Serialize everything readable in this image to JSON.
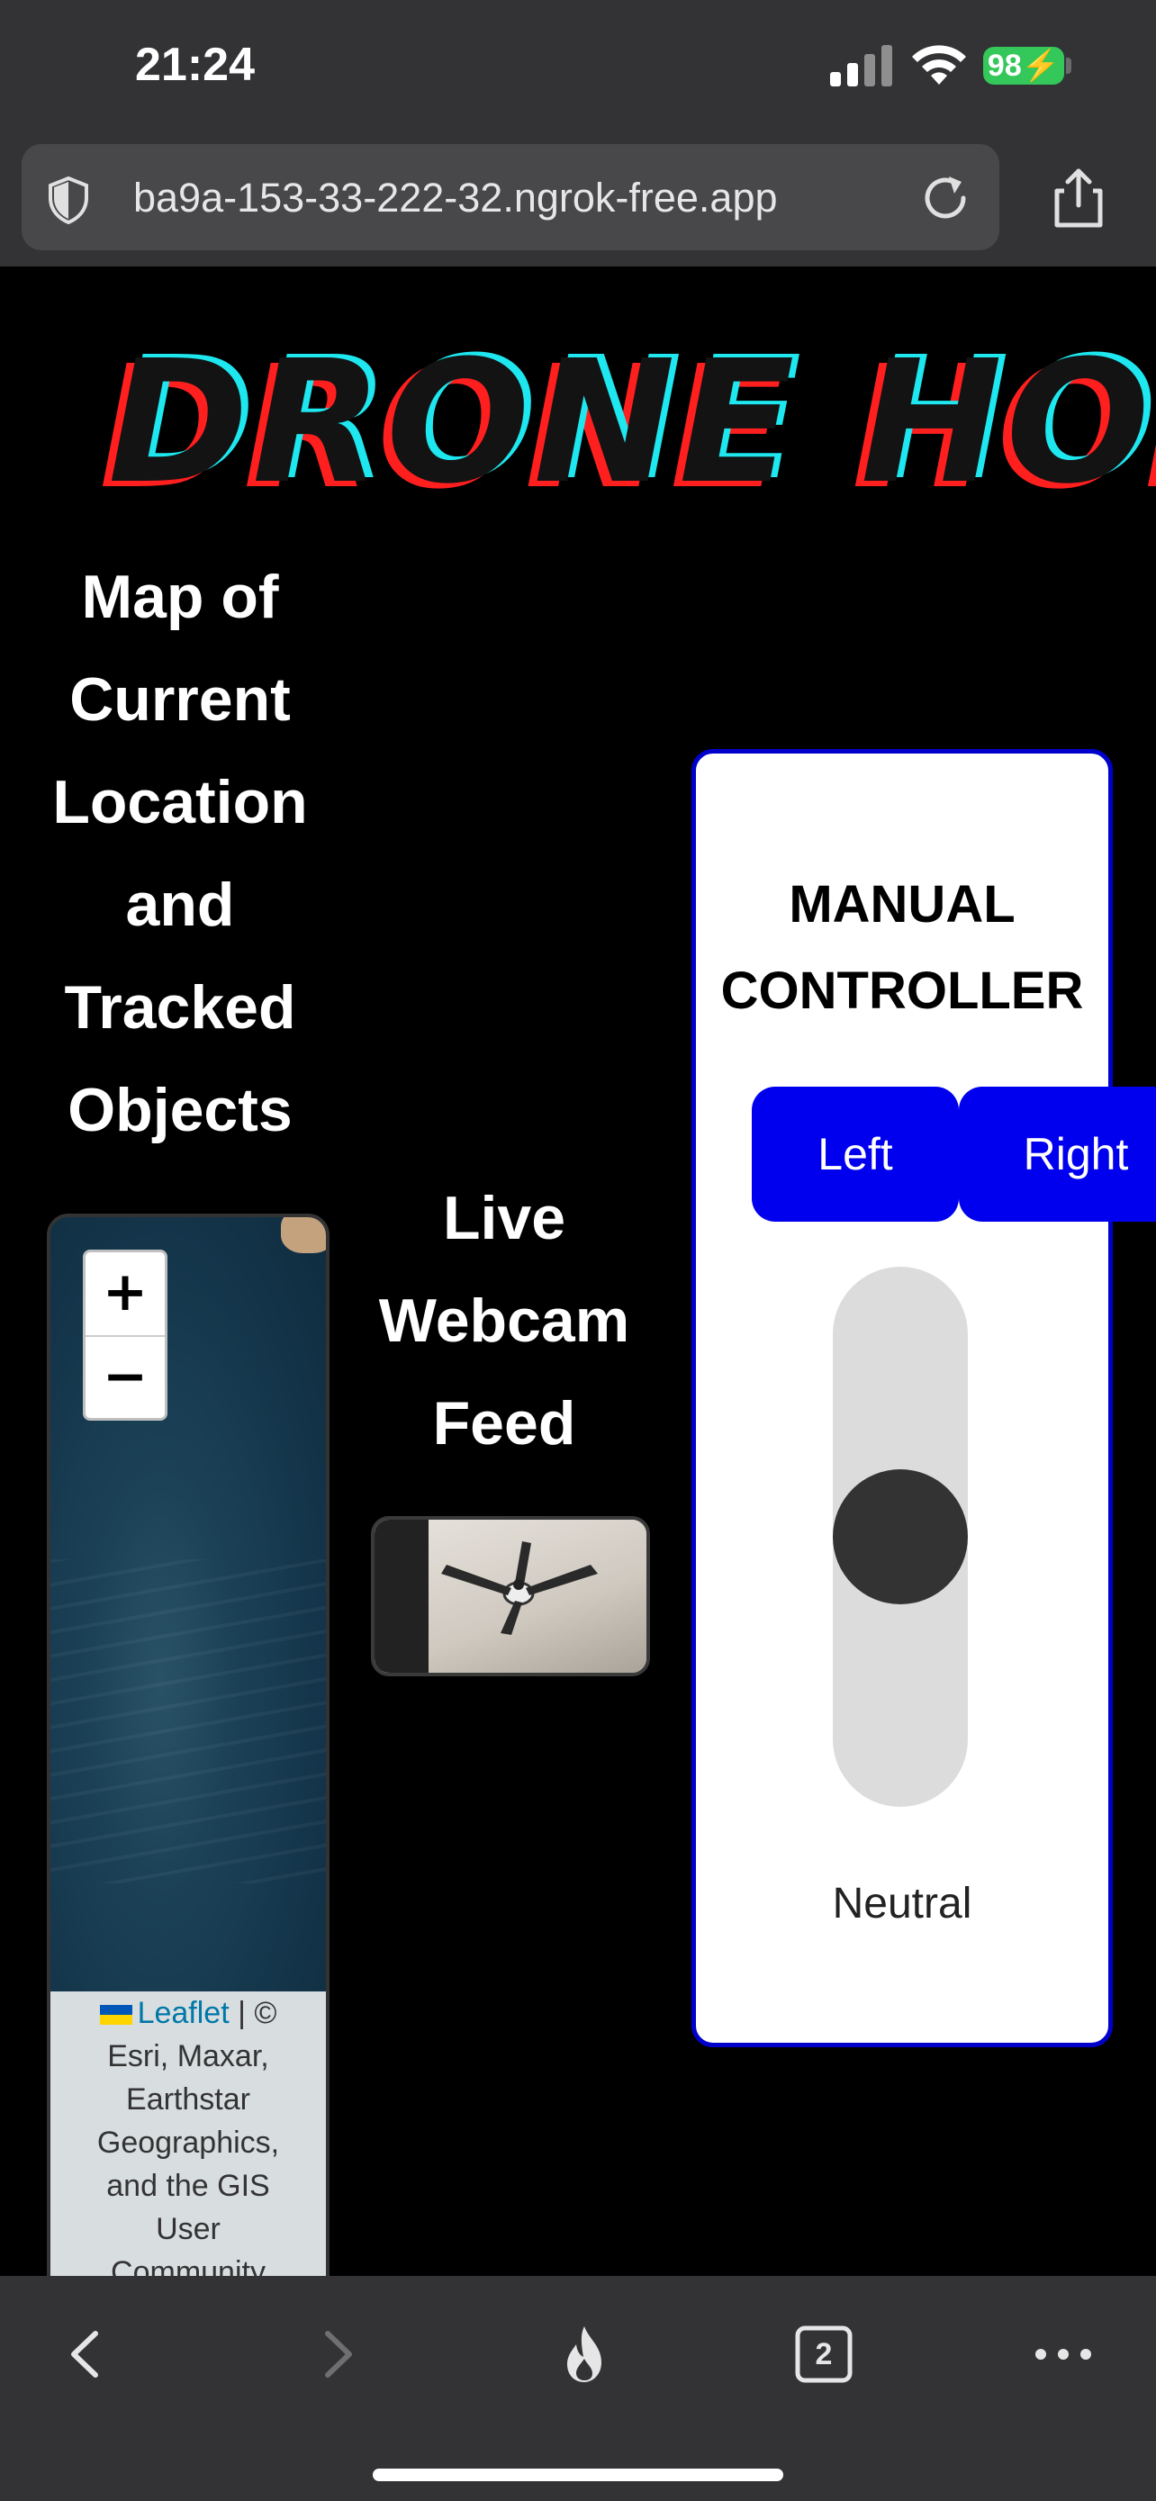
{
  "status_bar": {
    "time": "21:24",
    "battery": "98",
    "icons": [
      "signal-icon",
      "wifi-icon",
      "battery-icon"
    ]
  },
  "browser": {
    "url": "ba9a-153-33-222-32.ngrok-free.app",
    "icons": [
      "shield-icon",
      "reload-icon",
      "share-icon"
    ]
  },
  "page": {
    "title": "DRONE HOME",
    "map_section": {
      "heading_lines": [
        "Map of",
        "Current",
        "Location",
        "and",
        "Tracked",
        "Objects"
      ],
      "zoom_in": "+",
      "zoom_out": "−",
      "attribution": {
        "link": "Leaflet",
        "separator": " | © ",
        "text_lines": [
          "Esri, Maxar,",
          "Earthstar",
          "Geographics,",
          "and the GIS",
          "User",
          "Community"
        ]
      }
    },
    "webcam_section": {
      "heading_lines": [
        "Live",
        "Webcam",
        "Feed"
      ]
    },
    "controller": {
      "title_lines": [
        "MANUAL",
        "CONTROLLER"
      ],
      "left_label": "Left",
      "right_label": "Right",
      "throttle_state": "Neutral",
      "throttle_level": 0.5
    }
  },
  "toolbar": {
    "icons": [
      "back-icon",
      "forward-icon",
      "fire-icon",
      "tabs-icon",
      "more-icon"
    ],
    "tab_count": "2"
  },
  "colors": {
    "accent_blue": "#0000ee",
    "title_red": "#ff1f1f",
    "title_cyan": "#1ee7ef",
    "battery_green": "#34c759"
  }
}
